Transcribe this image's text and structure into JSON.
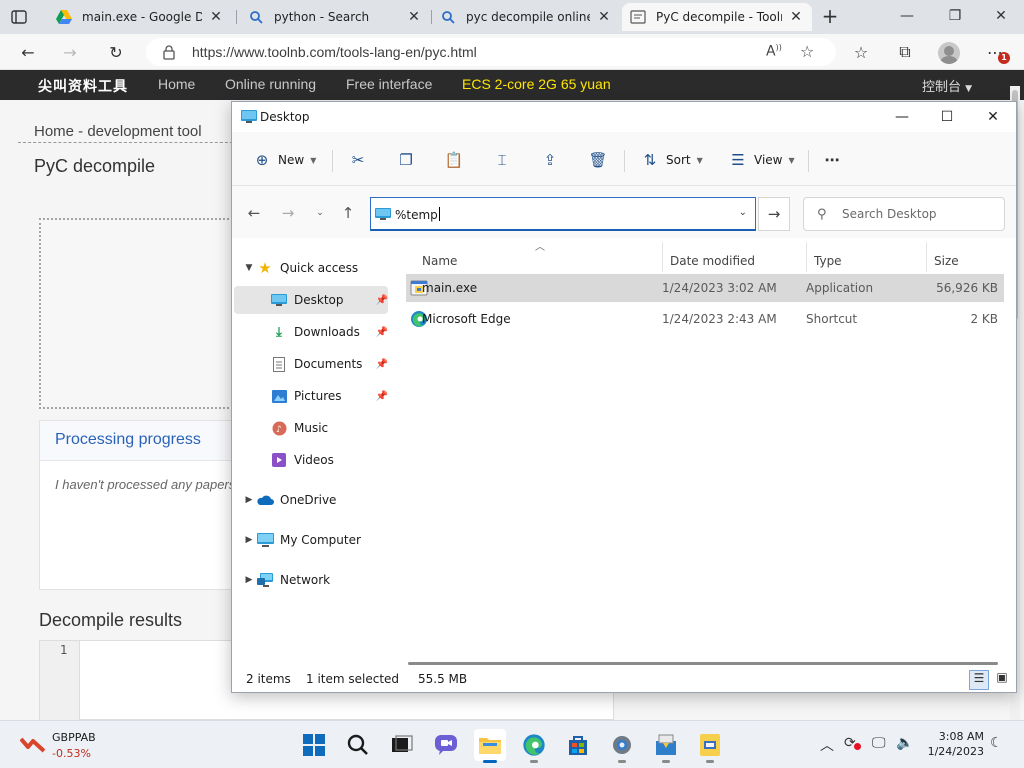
{
  "browser": {
    "tabs": [
      {
        "title": "main.exe - Google Drive",
        "favicon": "google-drive-icon"
      },
      {
        "title": "python - Search",
        "favicon": "search-icon"
      },
      {
        "title": "pyc decompile online -",
        "favicon": "search-icon"
      },
      {
        "title": "PyC decompile - Toolnb",
        "favicon": "page-icon",
        "active": true
      }
    ],
    "url": "https://www.toolnb.com/tools-lang-en/pyc.html",
    "notification_count": "1"
  },
  "site": {
    "logo": "尖叫资料工具",
    "nav": [
      "Home",
      "Online running",
      "Free interface",
      "ECS 2-core 2G 65 yuan"
    ],
    "console": "控制台",
    "breadcrumb": "Home - development tool",
    "title": "PyC decompile",
    "progress_title": "Processing progress",
    "progress_text": "I haven't processed any papers yet",
    "results_title": "Decompile results",
    "line_number": "1"
  },
  "explorer": {
    "title": "Desktop",
    "commands": {
      "new": "New",
      "sort": "Sort",
      "view": "View"
    },
    "address_value": "%temp",
    "search_placeholder": "Search Desktop",
    "sidebar": {
      "quick_access": "Quick access",
      "desktop": "Desktop",
      "downloads": "Downloads",
      "documents": "Documents",
      "pictures": "Pictures",
      "music": "Music",
      "videos": "Videos",
      "onedrive": "OneDrive",
      "my_computer": "My Computer",
      "network": "Network"
    },
    "columns": {
      "name": "Name",
      "date": "Date modified",
      "type": "Type",
      "size": "Size"
    },
    "files": [
      {
        "name": "main.exe",
        "date": "1/24/2023 3:02 AM",
        "type": "Application",
        "size": "56,926 KB"
      },
      {
        "name": "Microsoft Edge",
        "date": "1/24/2023 2:43 AM",
        "type": "Shortcut",
        "size": "2 KB"
      }
    ],
    "status": {
      "count": "2 items",
      "selected": "1 item selected",
      "size": "55.5 MB"
    }
  },
  "taskbar": {
    "ticker_symbol": "GBPPAB",
    "ticker_change": "-0.53%",
    "time": "3:08 AM",
    "date": "1/24/2023"
  },
  "colors": {
    "accent": "#0067c0",
    "site_nav_bg": "#2b2b2b",
    "nav_highlight": "#ffe600",
    "progress_title": "#2b62b8",
    "ticker_negative": "#c42b1c"
  }
}
